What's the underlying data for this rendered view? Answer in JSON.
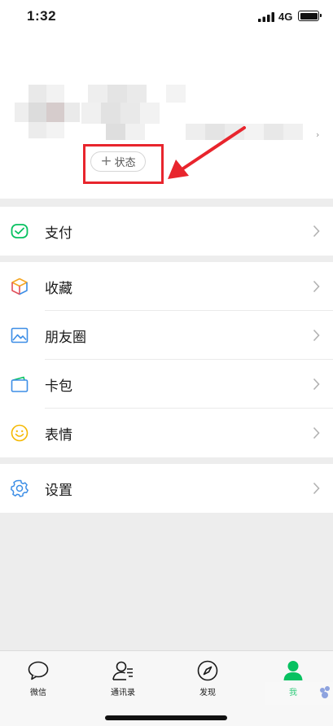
{
  "status_bar": {
    "time": "1:32",
    "network": "4G"
  },
  "profile": {
    "status_button_label": "状态"
  },
  "menu": {
    "pay": "支付",
    "favorites": "收藏",
    "moments": "朋友圈",
    "cards": "卡包",
    "stickers": "表情",
    "settings": "设置"
  },
  "tabbar": {
    "chats": "微信",
    "contacts": "通讯录",
    "discover": "发现",
    "me": "我"
  },
  "colors": {
    "accent_green": "#07c160",
    "annotation_red": "#e8252d",
    "background": "#ededed"
  },
  "icons": [
    "wechat-pay-icon",
    "favorites-cube-icon",
    "moments-photo-icon",
    "card-wallet-icon",
    "smiley-icon",
    "settings-gear-icon",
    "chat-bubble-icon",
    "contacts-icon",
    "compass-icon",
    "person-icon"
  ]
}
